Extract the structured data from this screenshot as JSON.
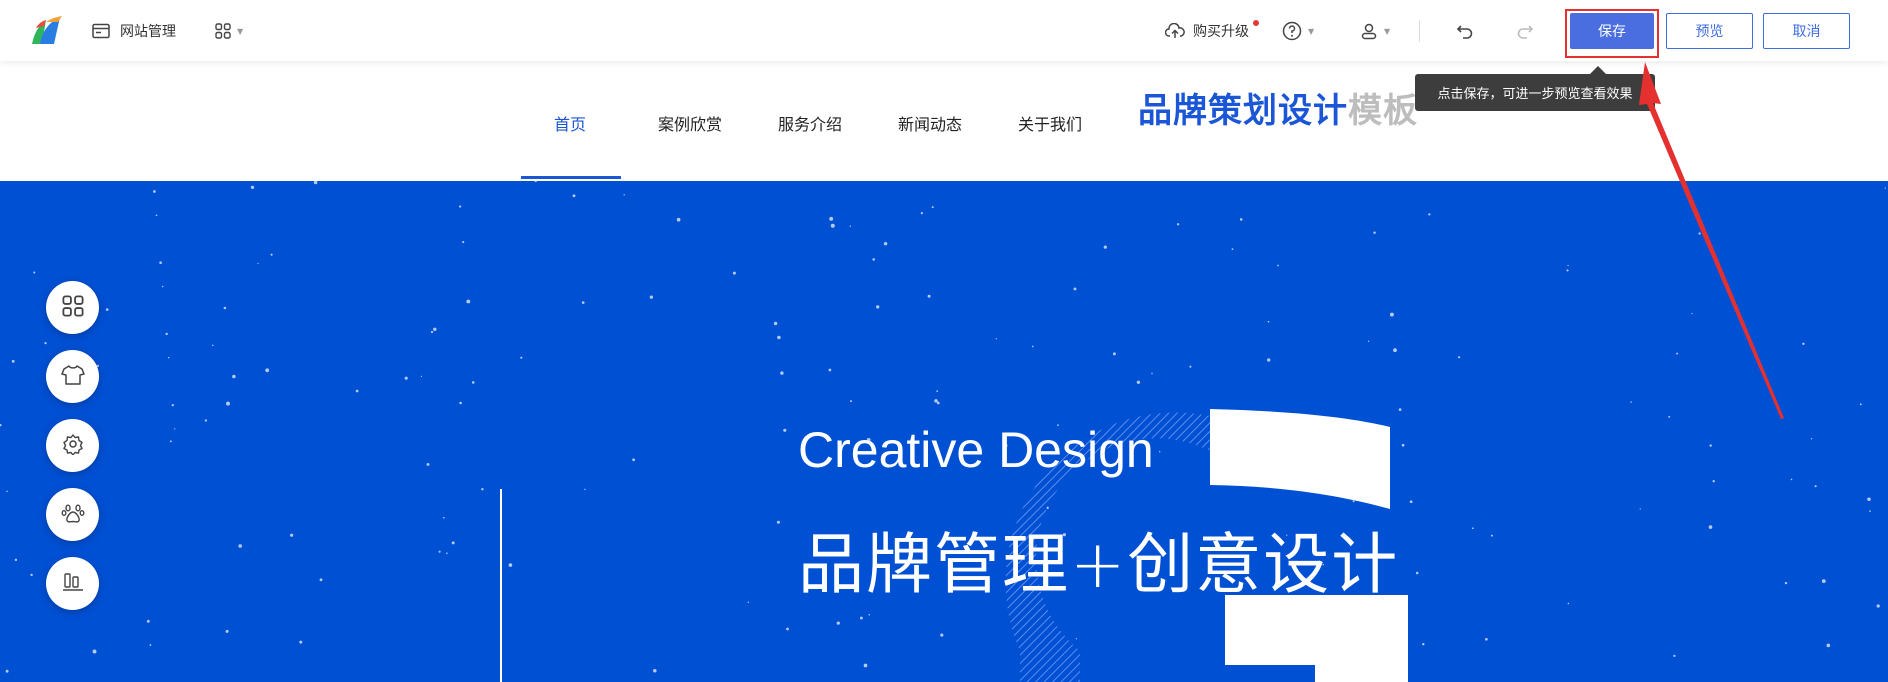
{
  "toolbar": {
    "site_manage_label": "网站管理",
    "buy_upgrade_label": "购买升级",
    "save_label": "保存",
    "preview_label": "预览",
    "cancel_label": "取消",
    "save_tooltip": "点击保存，可进一步预览查看效果",
    "icons": [
      "logo",
      "site-manage-icon",
      "apps-icon",
      "cloud-upload-icon",
      "help-icon",
      "user-icon",
      "undo-icon",
      "redo-icon"
    ]
  },
  "site_nav": {
    "items": [
      "首页",
      "案例欣赏",
      "服务介绍",
      "新闻动态",
      "关于我们"
    ],
    "active_index": 0,
    "brand_title_main": "品牌策划设计",
    "brand_title_suffix": "模板"
  },
  "hero": {
    "title_en": "Creative Design",
    "title_cn": "品牌管理+创意设计",
    "background_color": "#0050d4"
  },
  "side_tools": [
    "apps-icon",
    "shirt-icon",
    "settings-icon",
    "paw-icon",
    "components-icon"
  ],
  "colors": {
    "accent": "#1a56d6",
    "save_button": "#4a6ee0",
    "annotation_red": "#e53030"
  }
}
